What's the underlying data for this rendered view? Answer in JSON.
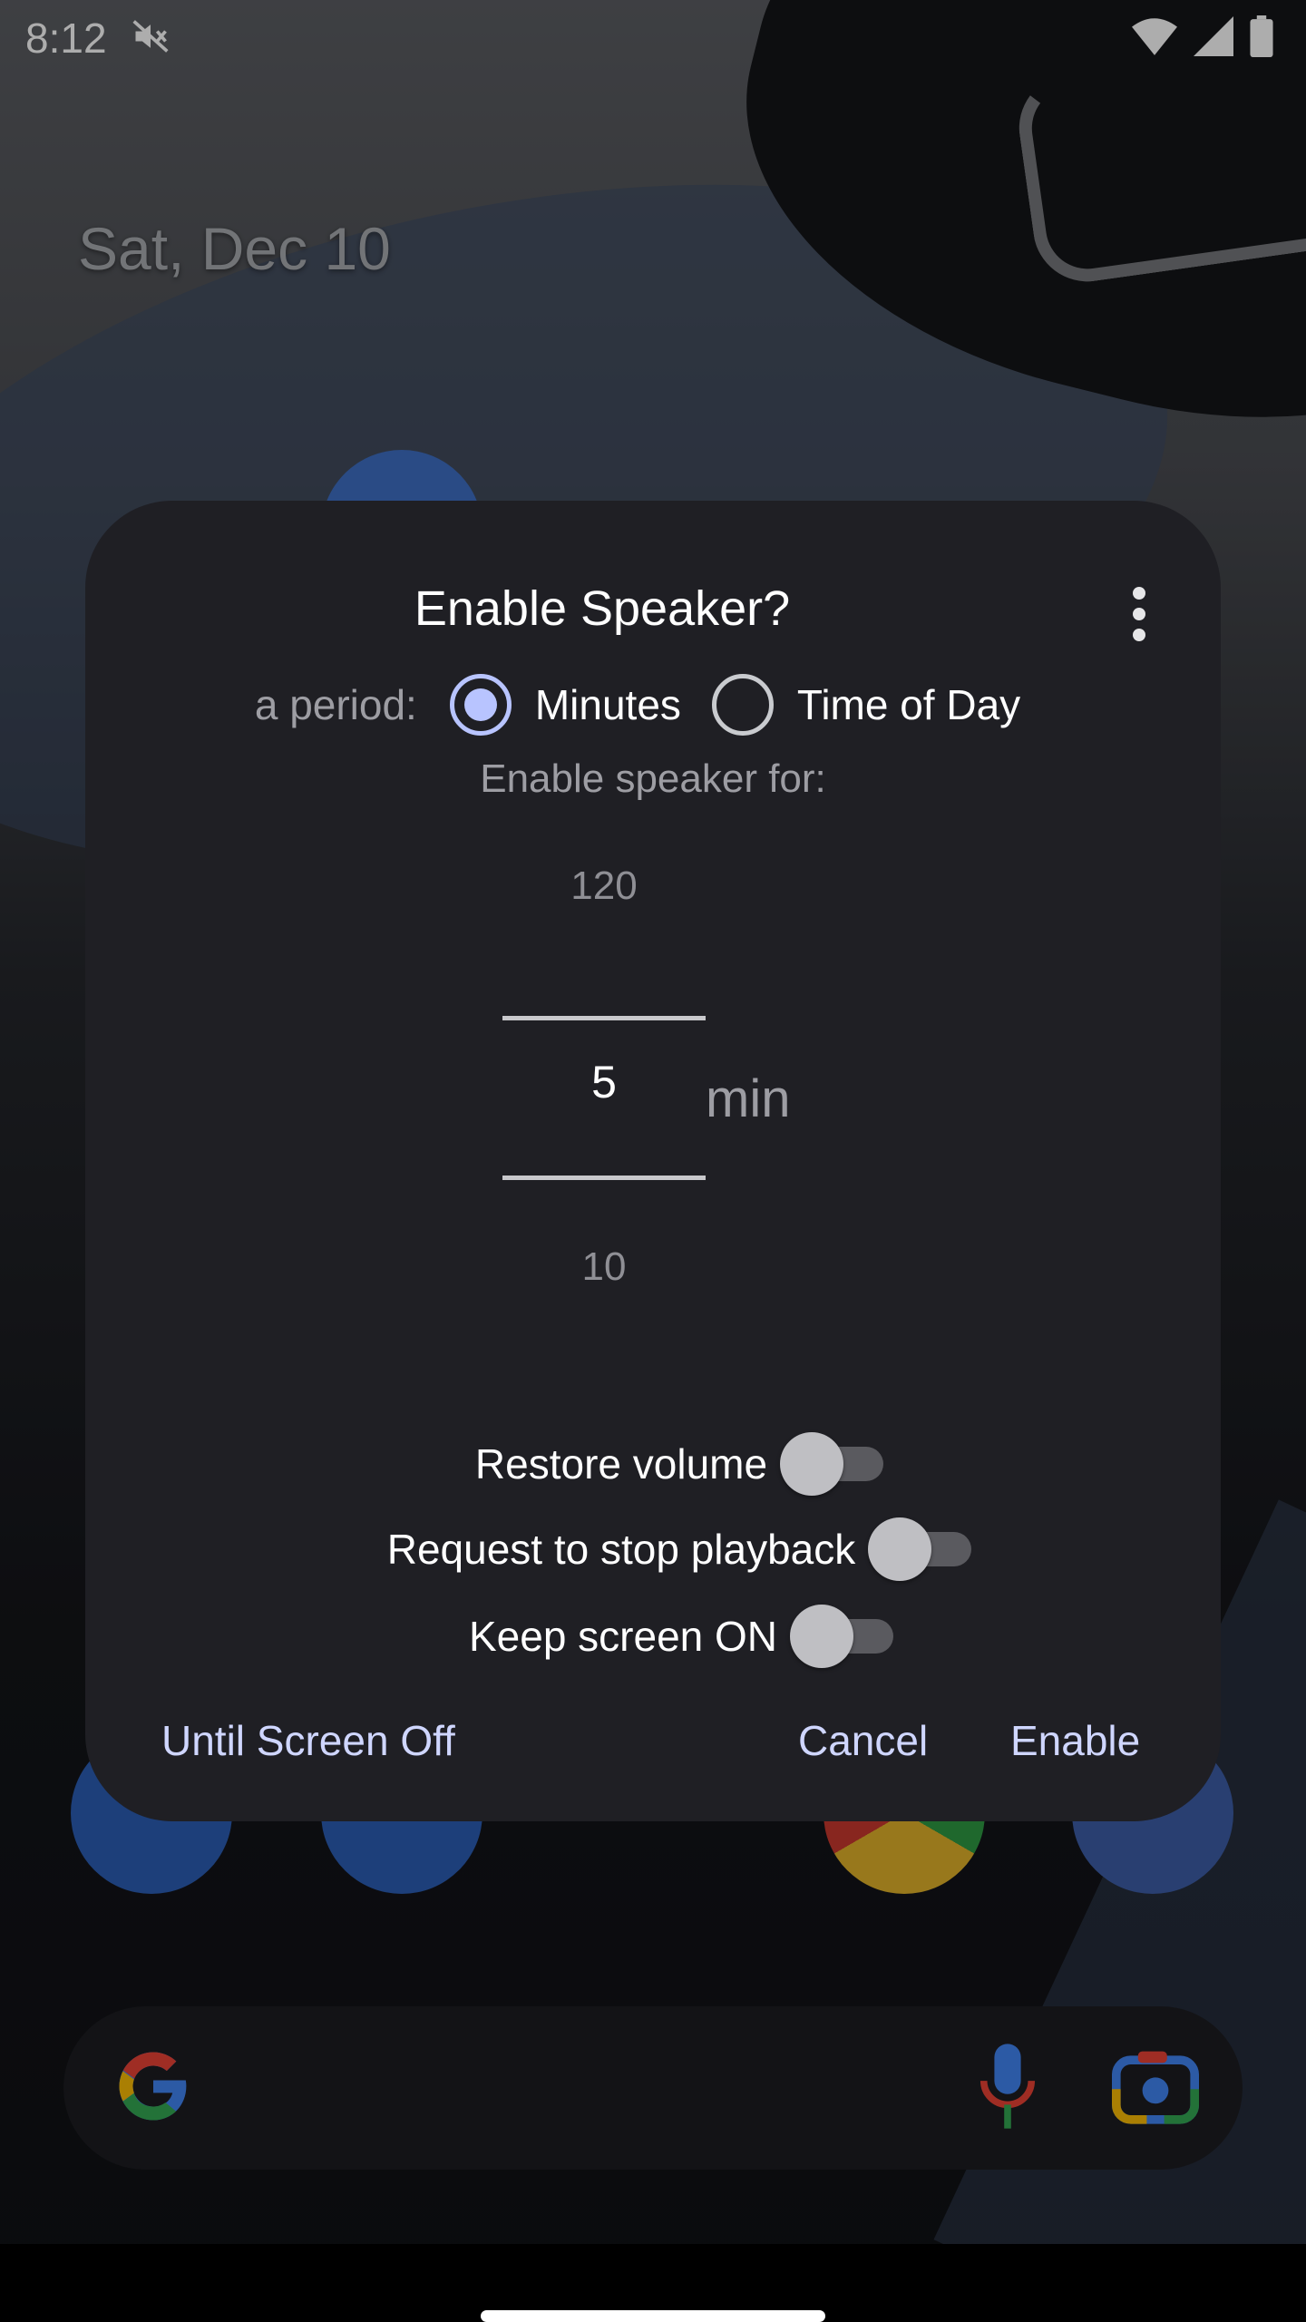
{
  "status_bar": {
    "time": "8:12",
    "icons": [
      "mute-icon",
      "wifi-icon",
      "cellular-signal-icon",
      "battery-icon"
    ]
  },
  "home": {
    "date": "Sat, Dec 10"
  },
  "dialog": {
    "title": "Enable Speaker?",
    "period_label": "a period:",
    "period_options": [
      {
        "label": "Minutes",
        "selected": true
      },
      {
        "label": "Time of Day",
        "selected": false
      }
    ],
    "subtitle": "Enable speaker for:",
    "picker": {
      "previous": "120",
      "current": "5",
      "next": "10",
      "unit": "min"
    },
    "toggles": [
      {
        "label": "Restore volume",
        "on": false
      },
      {
        "label": "Request to stop playback",
        "on": false
      },
      {
        "label": "Keep screen ON",
        "on": false
      }
    ],
    "buttons": {
      "until_screen_off": "Until Screen Off",
      "cancel": "Cancel",
      "enable": "Enable"
    }
  },
  "colors": {
    "dialog_bg": "#1f1f24",
    "accent": "#b8c4ff",
    "button_text": "#cfd6ff"
  }
}
